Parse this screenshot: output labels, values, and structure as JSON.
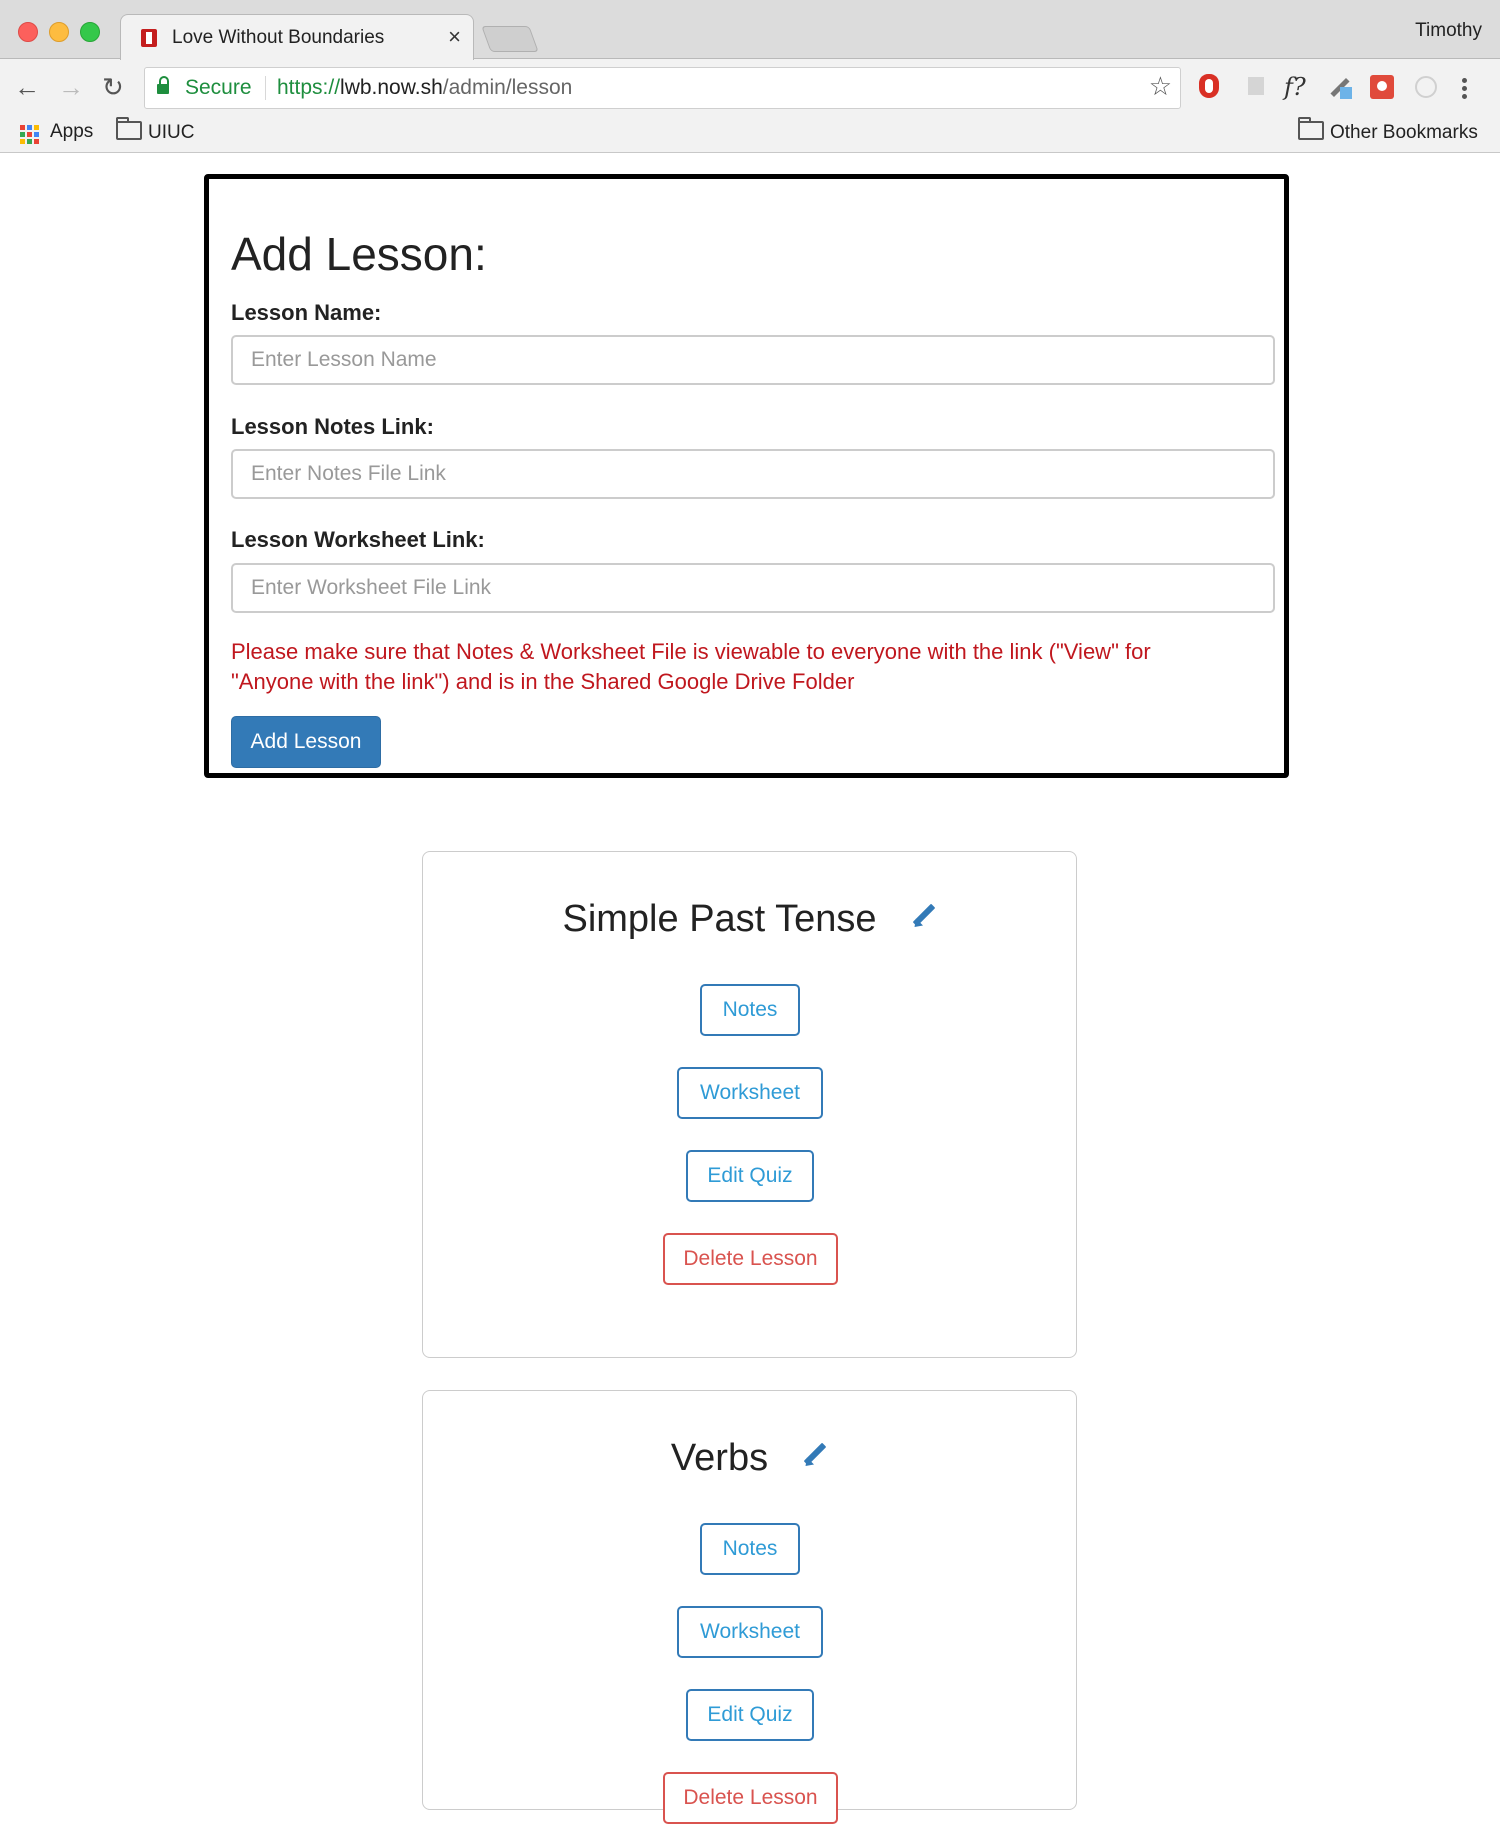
{
  "browser": {
    "tab_title": "Love Without Boundaries",
    "tab_close": "×",
    "profile_name": "Timothy",
    "secure_label": "Secure",
    "url_scheme": "https://",
    "url_host": "lwb.now.sh",
    "url_path": "/admin/lesson",
    "extension_fx_label": "f?",
    "bookmarks": {
      "apps_label": "Apps",
      "uiuc_label": "UIUC",
      "other_label": "Other Bookmarks"
    }
  },
  "add_lesson": {
    "title": "Add Lesson:",
    "name_label": "Lesson Name:",
    "name_placeholder": "Enter Lesson Name",
    "notes_label": "Lesson Notes Link:",
    "notes_placeholder": "Enter Notes File Link",
    "worksheet_label": "Lesson Worksheet Link:",
    "worksheet_placeholder": "Enter Worksheet File Link",
    "warning": "Please make sure that Notes & Worksheet File is viewable to everyone with the link (\"View\" for \"Anyone with the link\") and is in the Shared Google Drive Folder",
    "submit_label": "Add Lesson"
  },
  "lessons": [
    {
      "title": "Simple Past Tense",
      "notes_label": "Notes",
      "worksheet_label": "Worksheet",
      "edit_quiz_label": "Edit Quiz",
      "delete_label": "Delete Lesson"
    },
    {
      "title": "Verbs",
      "notes_label": "Notes",
      "worksheet_label": "Worksheet",
      "edit_quiz_label": "Edit Quiz",
      "delete_label": "Delete Lesson"
    }
  ],
  "colors": {
    "primary": "#337ab7",
    "link_text": "#2f9bd6",
    "danger": "#d9534f",
    "warning_text": "#c0171e",
    "secure_green": "#1e8e3e"
  }
}
